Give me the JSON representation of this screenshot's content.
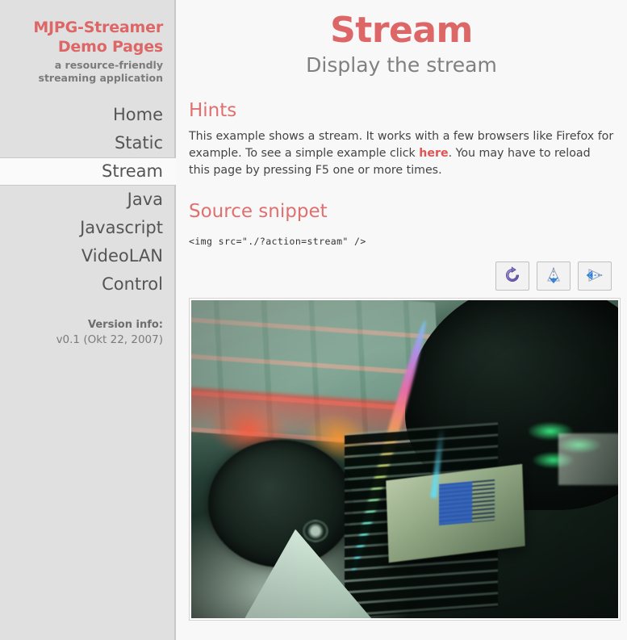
{
  "sidebar": {
    "brand_title_line1": "MJPG-Streamer",
    "brand_title_line2": "Demo Pages",
    "brand_subtitle": "a resource-friendly streaming application",
    "nav_items": [
      {
        "label": "Home",
        "active": false
      },
      {
        "label": "Static",
        "active": false
      },
      {
        "label": "Stream",
        "active": true
      },
      {
        "label": "Java",
        "active": false
      },
      {
        "label": "Javascript",
        "active": false
      },
      {
        "label": "VideoLAN",
        "active": false
      },
      {
        "label": "Control",
        "active": false
      }
    ],
    "version_label": "Version info:",
    "version_value": "v0.1 (Okt 22, 2007)"
  },
  "main": {
    "title": "Stream",
    "subtitle": "Display the stream",
    "hints_heading": "Hints",
    "hints_part1": "This example shows a stream. It works with a few browsers like Firefox for example. To see a simple example click ",
    "hints_link": "here",
    "hints_part2": ". You may have to reload this page by pressing F5 one or more times.",
    "source_heading": "Source snippet",
    "source_code": "<img src=\"./?action=stream\" />"
  },
  "controls": [
    {
      "name": "rotate-icon",
      "title": "Rotate"
    },
    {
      "name": "mirror-vertical-icon",
      "title": "Mirror vertical"
    },
    {
      "name": "mirror-horizontal-icon",
      "title": "Mirror horizontal"
    }
  ],
  "stream": {
    "alt": "live mjpg stream",
    "description": "Backlit red keyboard, Razer mouse with green logo and RGB strip, fan and circuit board"
  },
  "colors": {
    "accent": "#dd6666",
    "sidebar_bg": "#e0e0e0",
    "content_bg": "#f8f8f8",
    "text": "#555555",
    "link": "#dd5555"
  }
}
